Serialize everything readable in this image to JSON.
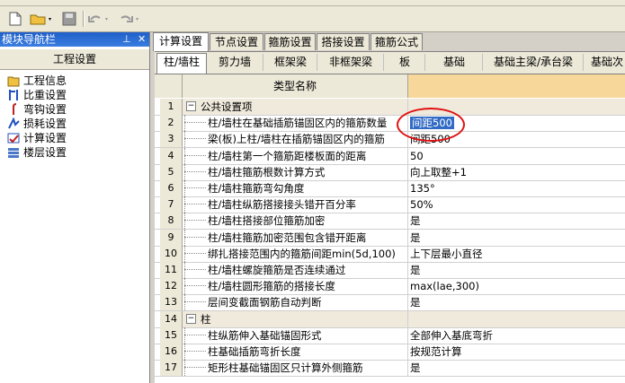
{
  "nav": {
    "title": "模块导航栏",
    "pin_icon": "pin-icon",
    "close_icon": "close-icon",
    "group": "工程设置",
    "items": [
      {
        "label": "工程信息",
        "icon": "folder-info-icon"
      },
      {
        "label": "比重设置",
        "icon": "weight-icon"
      },
      {
        "label": "弯钩设置",
        "icon": "hook-icon"
      },
      {
        "label": "损耗设置",
        "icon": "loss-icon"
      },
      {
        "label": "计算设置",
        "icon": "calc-settings-icon"
      },
      {
        "label": "楼层设置",
        "icon": "floor-icon"
      }
    ]
  },
  "tabs": [
    "计算设置",
    "节点设置",
    "箍筋设置",
    "搭接设置",
    "箍筋公式"
  ],
  "subtabs": [
    "柱/墙柱",
    "剪力墙",
    "框架梁",
    "非框架梁",
    "板",
    "基础",
    "基础主梁/承台梁",
    "基础次"
  ],
  "grid": {
    "header_name": "类型名称",
    "rows": [
      {
        "num": "1",
        "name": "公共设置项",
        "value": "",
        "group": true
      },
      {
        "num": "2",
        "name": "柱/墙柱在基础插筋锚固区内的箍筋数量",
        "value": "间距500",
        "selected": true
      },
      {
        "num": "3",
        "name": "梁(板)上柱/墙柱在插筋锚固区内的箍筋",
        "value": "间距500"
      },
      {
        "num": "4",
        "name": "柱/墙柱第一个箍筋距楼板面的距离",
        "value": "50"
      },
      {
        "num": "5",
        "name": "柱/墙柱箍筋根数计算方式",
        "value": "向上取整+1"
      },
      {
        "num": "6",
        "name": "柱/墙柱箍筋弯勾角度",
        "value": "135°"
      },
      {
        "num": "7",
        "name": "柱/墙柱纵筋搭接接头错开百分率",
        "value": "50%"
      },
      {
        "num": "8",
        "name": "柱/墙柱搭接部位箍筋加密",
        "value": "是"
      },
      {
        "num": "9",
        "name": "柱/墙柱箍筋加密范围包含错开距离",
        "value": "是"
      },
      {
        "num": "10",
        "name": "绑扎搭接范围内的箍筋间距min(5d,100)",
        "value": "上下层最小直径"
      },
      {
        "num": "11",
        "name": "柱/墙柱螺旋箍筋是否连续通过",
        "value": "是"
      },
      {
        "num": "12",
        "name": "柱/墙柱圆形箍筋的搭接长度",
        "value": "max(lae,300)"
      },
      {
        "num": "13",
        "name": "层间变截面钢筋自动判断",
        "value": "是"
      },
      {
        "num": "14",
        "name": "柱",
        "value": "",
        "group": true
      },
      {
        "num": "15",
        "name": "柱纵筋伸入基础锚固形式",
        "value": "全部伸入基底弯折"
      },
      {
        "num": "16",
        "name": "柱基础插筋弯折长度",
        "value": "按规范计算"
      },
      {
        "num": "17",
        "name": "矩形柱基础锚固区只计算外侧箍筋",
        "value": "是"
      }
    ]
  },
  "colors": {
    "selection": "#316ac5",
    "annotation": "#e01010",
    "header_value_bg": "#f7d79a"
  }
}
